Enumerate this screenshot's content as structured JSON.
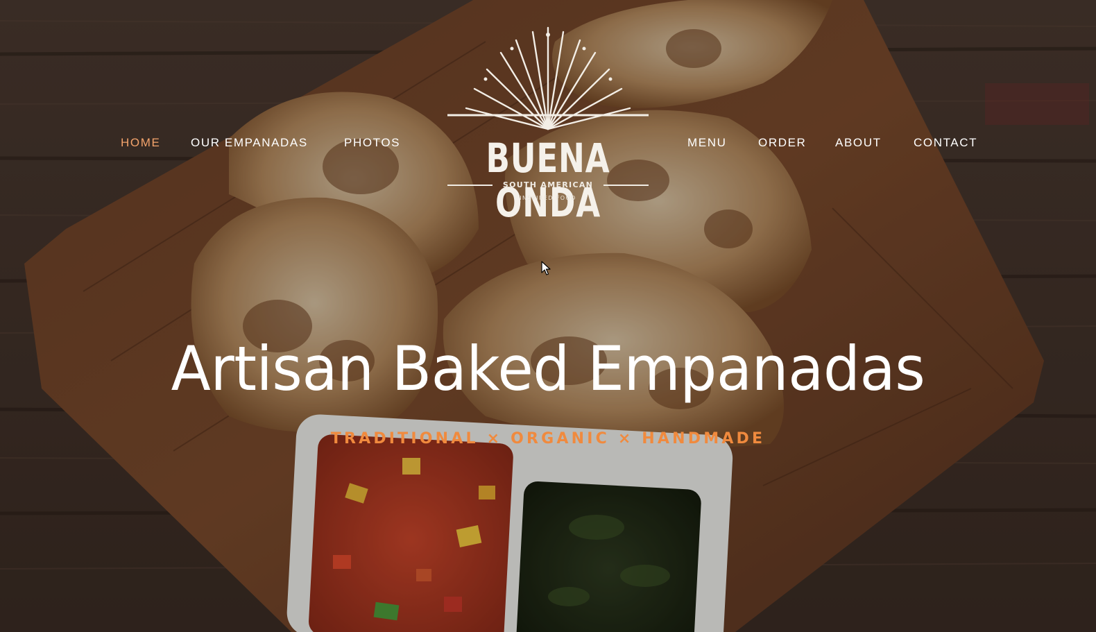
{
  "nav": {
    "left": [
      {
        "label": "HOME",
        "active": true
      },
      {
        "label": "OUR EMPANADAS",
        "active": false
      },
      {
        "label": "PHOTOS",
        "active": false
      }
    ],
    "right": [
      {
        "label": "MENU",
        "active": false
      },
      {
        "label": "ORDER",
        "active": false
      },
      {
        "label": "ABOUT",
        "active": false
      },
      {
        "label": "CONTACT",
        "active": false
      }
    ]
  },
  "logo": {
    "title": "BUENA ONDA",
    "subtitle": "SOUTH AMERICAN",
    "tagline": "INSPIRED FOOD"
  },
  "hero": {
    "headline": "Artisan Baked Empanadas",
    "tagline": "TRADITIONAL × ORGANIC × HANDMADE"
  },
  "colors": {
    "accent": "#f08a3e",
    "nav_active": "#f4a46c",
    "text": "#ffffff"
  },
  "icons": [
    "mouse-cursor-icon"
  ]
}
